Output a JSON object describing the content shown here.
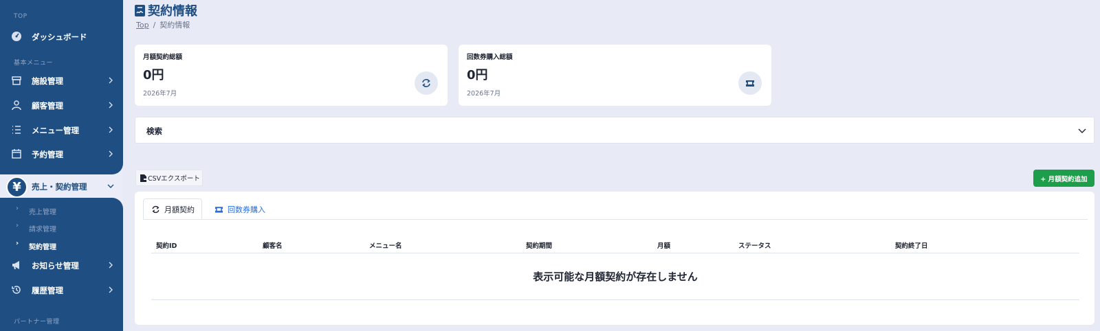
{
  "sidebar": {
    "section_top": "TOP",
    "dashboard": "ダッシュボード",
    "section_basic": "基本メニュー",
    "facility": "施設管理",
    "customer": "顧客管理",
    "menu": "メニュー管理",
    "reservation": "予約管理",
    "sales_contract": "売上・契約管理",
    "sub_items": [
      "売上管理",
      "請求管理",
      "契約管理"
    ],
    "notice": "お知らせ管理",
    "history": "履歴管理",
    "section_partner": "パートナー管理",
    "yen_symbol": "¥"
  },
  "header": {
    "title": "契約情報",
    "breadcrumb_home": "Top",
    "breadcrumb_sep": "/",
    "breadcrumb_current": "契約情報"
  },
  "cards": [
    {
      "label": "月額契約総額",
      "value": "0円",
      "date": "2026年7月",
      "icon": "repeat-icon"
    },
    {
      "label": "回数券購入総額",
      "value": "0円",
      "date": "2026年7月",
      "icon": "ticket-icon"
    }
  ],
  "search": {
    "label": "検索"
  },
  "buttons": {
    "csv": "CSVエクスポート",
    "add": "+ 月額契約追加"
  },
  "tabs": [
    "月額契約",
    "回数券購入"
  ],
  "table": {
    "columns": [
      "契約ID",
      "顧客名",
      "メニュー名",
      "契約期間",
      "月額",
      "ステータス",
      "契約終了日"
    ],
    "empty_message": "表示可能な月額契約が存在しません"
  },
  "colors": {
    "primary": "#1f4e83",
    "accent_green": "#1c9e4a",
    "link_blue": "#2a6fdb",
    "background": "#e8ebf6"
  }
}
